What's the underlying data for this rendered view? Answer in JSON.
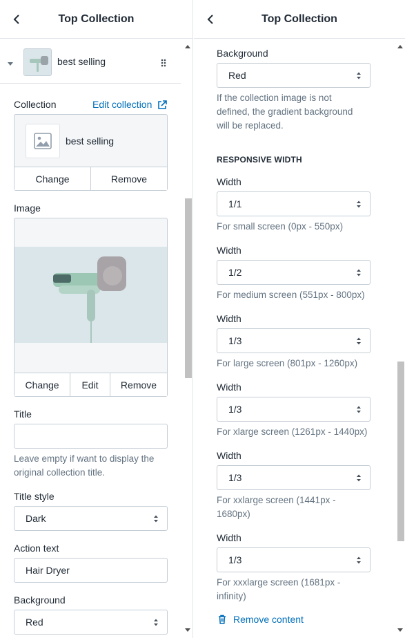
{
  "left": {
    "header_title": "Top Collection",
    "block_name": "best selling",
    "collection_label": "Collection",
    "edit_collection_link": "Edit collection",
    "collection_card_name": "best selling",
    "change_label": "Change",
    "remove_label": "Remove",
    "image_label": "Image",
    "image_buttons": [
      "Change",
      "Edit",
      "Remove"
    ],
    "title_label": "Title",
    "title_value": "",
    "title_help": [
      "Leave empty if want to display the",
      "original collection title."
    ],
    "title_style_label": "Title style",
    "title_style_value": "Dark",
    "action_text_label": "Action text",
    "action_text_value": "Hair Dryer",
    "background_label": "Background",
    "background_value": "Red"
  },
  "right": {
    "header_title": "Top Collection",
    "background_label": "Background",
    "background_value": "Red",
    "background_help": [
      "If the collection image is not",
      "defined, the gradient background",
      "will be replaced."
    ],
    "responsive_heading": "RESPONSIVE WIDTH",
    "widths": [
      {
        "label": "Width",
        "value": "1/1",
        "help": [
          "For small screen (0px - 550px)"
        ]
      },
      {
        "label": "Width",
        "value": "1/2",
        "help": [
          "For medium screen (551px - 800px)"
        ]
      },
      {
        "label": "Width",
        "value": "1/3",
        "help": [
          "For large screen (801px - 1260px)"
        ]
      },
      {
        "label": "Width",
        "value": "1/3",
        "help": [
          "For xlarge screen (1261px - 1440px)"
        ]
      },
      {
        "label": "Width",
        "value": "1/3",
        "help": [
          "For xxlarge screen (1441px -",
          "1680px)"
        ]
      },
      {
        "label": "Width",
        "value": "1/3",
        "help": [
          "For xxxlarge screen (1681px -",
          "infinity)"
        ]
      }
    ],
    "remove_content_label": "Remove content"
  },
  "colors": {
    "accent": "#006fbb",
    "text": "#212b36",
    "muted": "#637381",
    "border": "#c4cdd5",
    "image_bg": "#dbe6ea"
  },
  "icons": [
    "chevron-left-icon",
    "caret-down-icon",
    "drag-handle-icon",
    "external-link-icon",
    "image-placeholder-icon",
    "select-arrows-icon",
    "trash-icon"
  ]
}
